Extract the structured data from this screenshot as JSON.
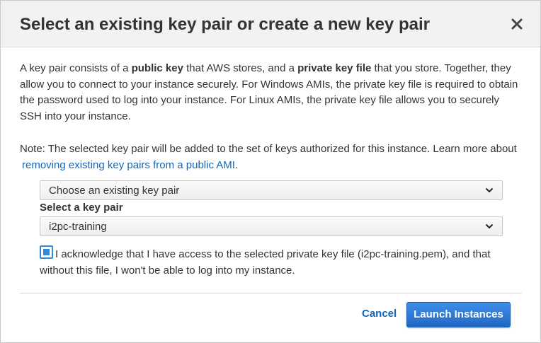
{
  "dialog": {
    "title": "Select an existing key pair or create a new key pair",
    "close_icon": "close-icon"
  },
  "description": {
    "part1": "A key pair consists of a ",
    "bold1": "public key",
    "part2": " that AWS stores, and a ",
    "bold2": "private key file",
    "part3": " that you store. Together, they allow you to connect to your instance securely. For Windows AMIs, the private key file is required to obtain the password used to log into your instance. For Linux AMIs, the private key file allows you to securely SSH into your instance."
  },
  "note": {
    "text": "Note: The selected key pair will be added to the set of keys authorized for this instance. Learn more about",
    "link": "removing existing key pairs from a public AMI",
    "suffix": "."
  },
  "key_pair_mode": {
    "selected": "Choose an existing key pair"
  },
  "key_pair_select": {
    "label": "Select a key pair",
    "selected": "i2pc-training"
  },
  "acknowledge": {
    "checked": true,
    "text": "I acknowledge that I have access to the selected private key file (i2pc-training.pem), and that without this file, I won't be able to log into my instance."
  },
  "footer": {
    "cancel_label": "Cancel",
    "launch_label": "Launch Instances"
  },
  "colors": {
    "link": "#1166bb",
    "primary_button": "#2a74d2",
    "header_bg": "#f2f2f2"
  }
}
